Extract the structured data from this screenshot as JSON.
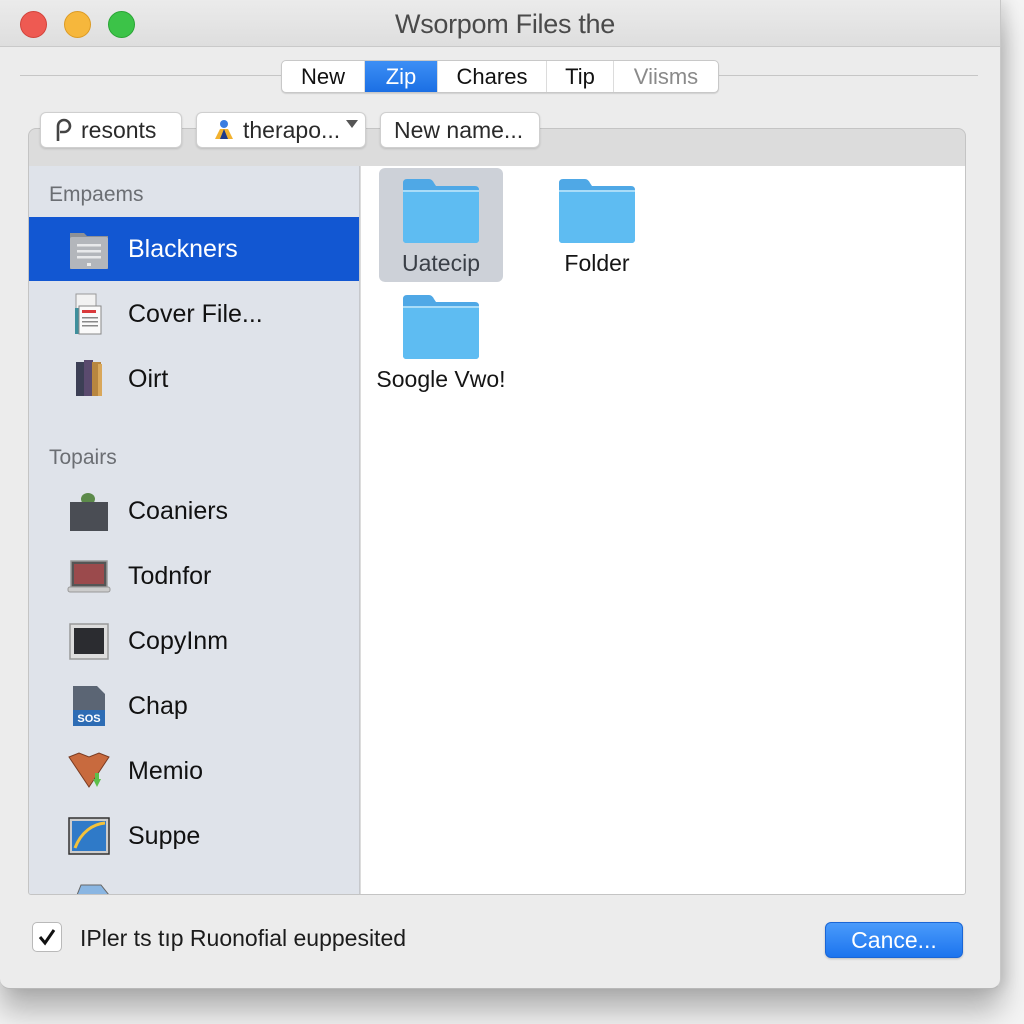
{
  "window": {
    "title": "Wsorpom Files the"
  },
  "tabs": [
    {
      "label": "New",
      "active": false
    },
    {
      "label": "Zip",
      "active": true
    },
    {
      "label": "Chares",
      "active": false
    },
    {
      "label": "Tip",
      "active": false
    },
    {
      "label": "Viisms",
      "active": false,
      "disabled": true
    }
  ],
  "toolbar": {
    "recents_label": "resonts",
    "recents_icon": "p-glyph-icon",
    "location_label": "therapo...",
    "location_icon": "person-icon",
    "new_name_label": "New name..."
  },
  "sidebar": {
    "sections": [
      {
        "header": "Empaems",
        "items": [
          {
            "label": "Blackners",
            "icon": "cabinet-folder-icon",
            "selected": true
          },
          {
            "label": "Cover File...",
            "icon": "document-icon",
            "selected": false
          },
          {
            "label": "Oirt",
            "icon": "books-icon",
            "selected": false
          }
        ]
      },
      {
        "header": "Topairs",
        "items": [
          {
            "label": "Coaniers",
            "icon": "box-icon",
            "selected": false
          },
          {
            "label": "Todnfor",
            "icon": "laptop-icon",
            "selected": false
          },
          {
            "label": "CopyInm",
            "icon": "monitor-icon",
            "selected": false
          },
          {
            "label": "Chap",
            "icon": "sos-file-icon",
            "selected": false
          },
          {
            "label": "Memio",
            "icon": "funnel-download-icon",
            "selected": false
          },
          {
            "label": "Suppe",
            "icon": "browser-icon",
            "selected": false
          }
        ]
      }
    ]
  },
  "files": [
    {
      "name": "Uatecip",
      "icon": "folder-icon",
      "selected": true
    },
    {
      "name": "Folder",
      "icon": "folder-icon",
      "selected": false
    },
    {
      "name": "Soogle Vwo!",
      "icon": "folder-icon",
      "selected": false
    }
  ],
  "footer": {
    "checkbox_label": "IPler ts tıp Ruonofial euppesited",
    "checkbox_checked": true,
    "primary_button": "Cance..."
  },
  "colors": {
    "accent": "#1b6fe4",
    "sidebar_selected": "#1257d2",
    "folder": "#5bb8f0"
  }
}
